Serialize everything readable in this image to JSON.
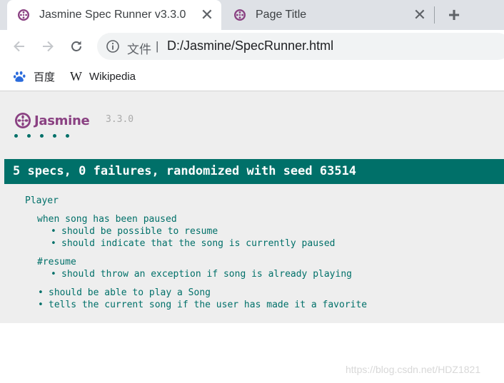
{
  "tabs": [
    {
      "title": "Jasmine Spec Runner v3.3.0",
      "active": true,
      "close": "✕"
    },
    {
      "title": "Page Title",
      "active": false,
      "close": "✕"
    }
  ],
  "new_tab": "+",
  "toolbar": {
    "back_icon": "arrow-left-icon",
    "forward_icon": "arrow-right-icon",
    "reload_icon": "reload-icon",
    "address": {
      "scheme_label": "文件",
      "separator": "|",
      "url": "D:/Jasmine/SpecRunner.html"
    }
  },
  "bookmarks": [
    {
      "label": "百度",
      "icon": "baidu-paw-icon"
    },
    {
      "label": "Wikipedia",
      "icon": "wikipedia-w-icon",
      "glyph": "W"
    }
  ],
  "jasmine": {
    "logo_text": "Jasmine",
    "version": "3.3.0",
    "passed_dot_count": 5,
    "summary": "5 specs, 0 failures, randomized with seed 63514",
    "suite": "Player",
    "nested_suites": [
      {
        "title": "when song has been paused",
        "specs": [
          "should be possible to resume",
          "should indicate that the song is currently paused"
        ]
      },
      {
        "title": "#resume",
        "specs": [
          "should throw an exception if song is already playing"
        ]
      }
    ],
    "specs": [
      "should be able to play a Song",
      "tells the current song if the user has made it a favorite"
    ]
  },
  "watermark": "https://blog.csdn.net/HDZ1821",
  "colors": {
    "jasmine_purple": "#8a4182",
    "jasmine_green": "#007069",
    "tab_strip": "#dee1e6"
  }
}
